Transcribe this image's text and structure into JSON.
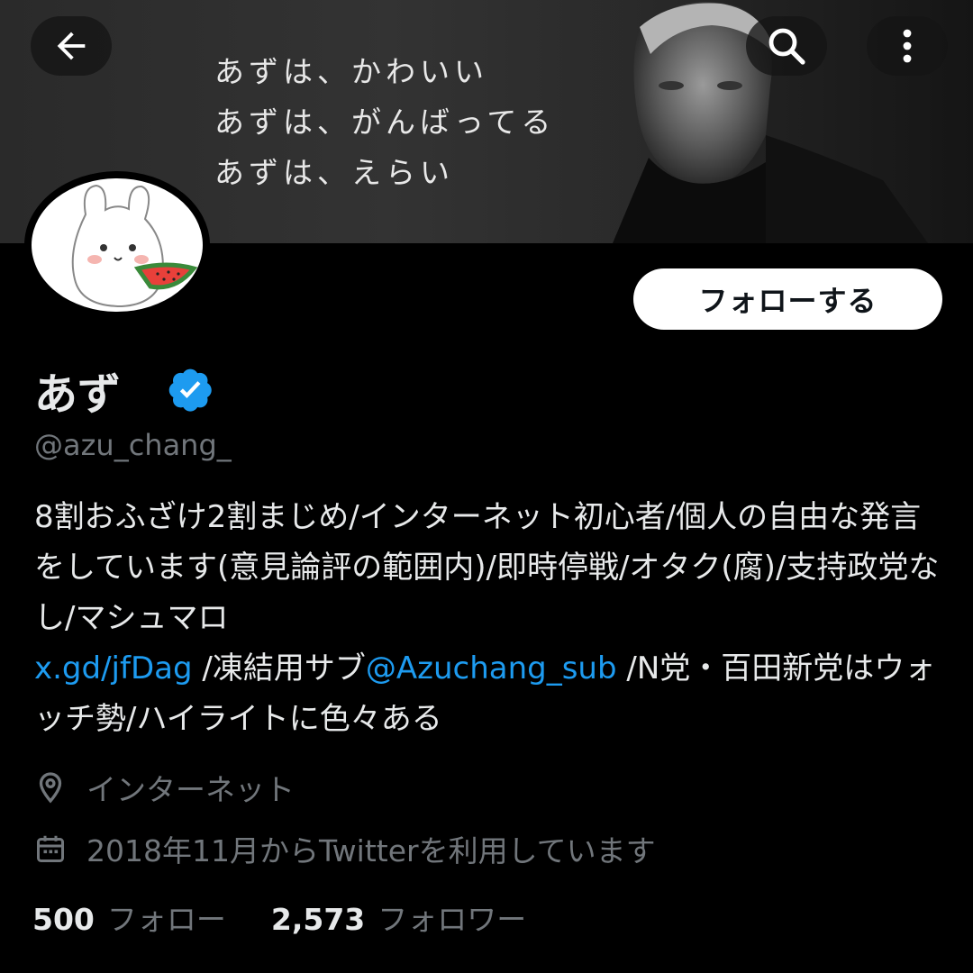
{
  "banner": {
    "lines": [
      "あずは、かわいい",
      "あずは、がんばってる",
      "あずは、えらい"
    ]
  },
  "header_icons": {
    "back": "back-arrow-icon",
    "search": "search-icon",
    "more": "more-vertical-icon"
  },
  "profile": {
    "name": "あず",
    "verified": true,
    "handle": "@azu_chang_",
    "follow_label": "フォローする",
    "bio": {
      "part1": "8割おふざけ2割まじめ/インターネット初心者/個人の自由な発言をしています(意見論評の範囲内)/即時停戦/オタク(腐)/支持政党なし/マシュマロ",
      "link1": "x.gd/jfDag",
      "part2": "/凍結用サブ",
      "mention": "@Azuchang_sub",
      "part3": "/N党・百田新党はウォッチ勢/ハイライトに色々ある"
    },
    "location": "インターネット",
    "joined": "2018年11月からTwitterを利用しています",
    "following_count": "500",
    "following_label": "フォロー",
    "followers_count": "2,573",
    "followers_label": "フォロワー"
  },
  "colors": {
    "background": "#000000",
    "text": "#e7e9ea",
    "muted": "#71767b",
    "link": "#1d9bf0",
    "verified": "#1d9bf0"
  }
}
